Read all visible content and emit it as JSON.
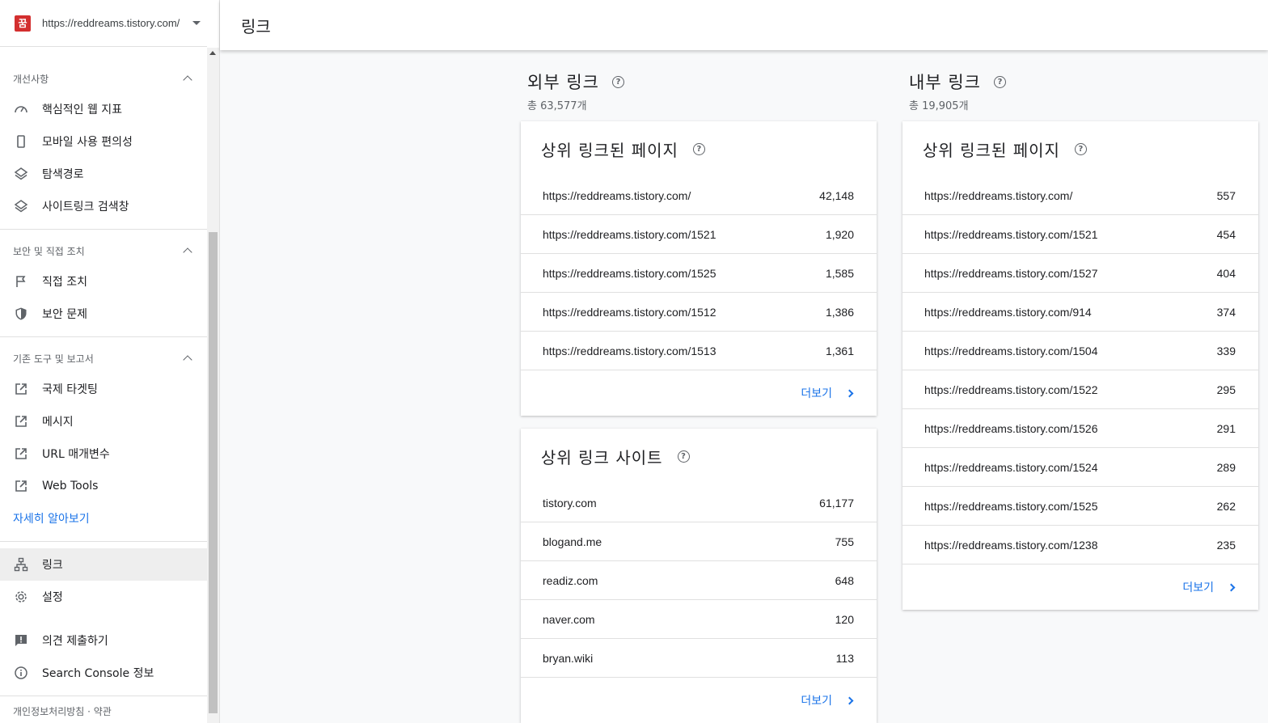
{
  "property": {
    "favicon": "꿈",
    "url": "https://reddreams.tistory.com/"
  },
  "sections": [
    {
      "label": "개선사항",
      "items": [
        {
          "label": "핵심적인 웹 지표",
          "icon": "gauge-icon"
        },
        {
          "label": "모바일 사용 편의성",
          "icon": "phone-icon"
        },
        {
          "label": "탐색경로",
          "icon": "layers-icon"
        },
        {
          "label": "사이트링크 검색창",
          "icon": "layers-icon"
        }
      ]
    },
    {
      "label": "보안 및 직접 조치",
      "items": [
        {
          "label": "직접 조치",
          "icon": "flag-icon"
        },
        {
          "label": "보안 문제",
          "icon": "shield-icon"
        }
      ]
    },
    {
      "label": "기존 도구 및 보고서",
      "items": [
        {
          "label": "국제 타겟팅",
          "icon": "external-link-icon"
        },
        {
          "label": "메시지",
          "icon": "external-link-icon"
        },
        {
          "label": "URL 매개변수",
          "icon": "external-link-icon"
        },
        {
          "label": "Web Tools",
          "icon": "external-link-icon"
        }
      ]
    }
  ],
  "learn_more": "자세히 알아보기",
  "bottom_nav": {
    "links": "링크",
    "settings": "설정",
    "feedback": "의견 제출하기",
    "about": "Search Console 정보",
    "footer": "개인정보처리방침 · 약관"
  },
  "header": {
    "title": "링크"
  },
  "external": {
    "title": "외부 링크",
    "total": "총 63,577개",
    "top_pages": {
      "title": "상위 링크된 페이지",
      "rows": [
        {
          "url": "https://reddreams.tistory.com/",
          "count": "42,148"
        },
        {
          "url": "https://reddreams.tistory.com/1521",
          "count": "1,920"
        },
        {
          "url": "https://reddreams.tistory.com/1525",
          "count": "1,585"
        },
        {
          "url": "https://reddreams.tistory.com/1512",
          "count": "1,386"
        },
        {
          "url": "https://reddreams.tistory.com/1513",
          "count": "1,361"
        }
      ],
      "more": "더보기"
    },
    "top_sites": {
      "title": "상위 링크 사이트",
      "rows": [
        {
          "url": "tistory.com",
          "count": "61,177"
        },
        {
          "url": "blogand.me",
          "count": "755"
        },
        {
          "url": "readiz.com",
          "count": "648"
        },
        {
          "url": "naver.com",
          "count": "120"
        },
        {
          "url": "bryan.wiki",
          "count": "113"
        }
      ],
      "more": "더보기"
    }
  },
  "internal": {
    "title": "내부 링크",
    "total": "총 19,905개",
    "top_pages": {
      "title": "상위 링크된 페이지",
      "rows": [
        {
          "url": "https://reddreams.tistory.com/",
          "count": "557"
        },
        {
          "url": "https://reddreams.tistory.com/1521",
          "count": "454"
        },
        {
          "url": "https://reddreams.tistory.com/1527",
          "count": "404"
        },
        {
          "url": "https://reddreams.tistory.com/914",
          "count": "374"
        },
        {
          "url": "https://reddreams.tistory.com/1504",
          "count": "339"
        },
        {
          "url": "https://reddreams.tistory.com/1522",
          "count": "295"
        },
        {
          "url": "https://reddreams.tistory.com/1526",
          "count": "291"
        },
        {
          "url": "https://reddreams.tistory.com/1524",
          "count": "289"
        },
        {
          "url": "https://reddreams.tistory.com/1525",
          "count": "262"
        },
        {
          "url": "https://reddreams.tistory.com/1238",
          "count": "235"
        }
      ],
      "more": "더보기"
    }
  },
  "colors": {
    "accent": "#1a73e8",
    "favicon": "#d32f2f"
  }
}
